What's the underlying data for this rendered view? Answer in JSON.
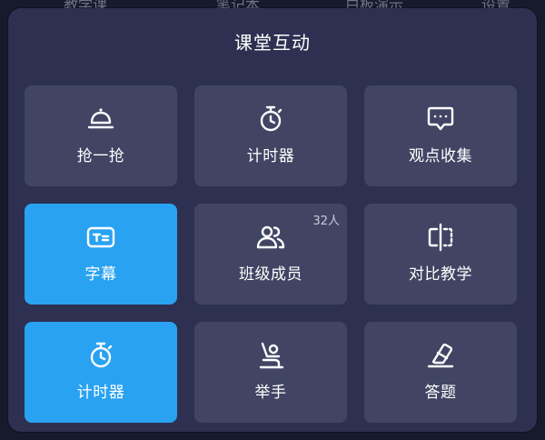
{
  "background_strip": [
    "教学课",
    "笔记本",
    "白板演示",
    "设置"
  ],
  "panel": {
    "title": "课堂互动"
  },
  "tiles": [
    {
      "label": "抢一抢",
      "icon": "bell-icon",
      "active": false,
      "badge": ""
    },
    {
      "label": "计时器",
      "icon": "stopwatch-icon",
      "active": false,
      "badge": ""
    },
    {
      "label": "观点收集",
      "icon": "chat-bubble-icon",
      "active": false,
      "badge": ""
    },
    {
      "label": "字幕",
      "icon": "caption-icon",
      "active": true,
      "badge": ""
    },
    {
      "label": "班级成员",
      "icon": "people-icon",
      "active": false,
      "badge": "32人"
    },
    {
      "label": "对比教学",
      "icon": "compare-icon",
      "active": false,
      "badge": ""
    },
    {
      "label": "计时器",
      "icon": "stopwatch-icon",
      "active": true,
      "badge": ""
    },
    {
      "label": "举手",
      "icon": "raise-hand-icon",
      "active": false,
      "badge": ""
    },
    {
      "label": "答题",
      "icon": "eraser-answer-icon",
      "active": false,
      "badge": ""
    }
  ],
  "colors": {
    "panel": "#2d3050",
    "tile": "#414563",
    "tile_active": "#2aa2f2",
    "text": "#ffffff"
  }
}
